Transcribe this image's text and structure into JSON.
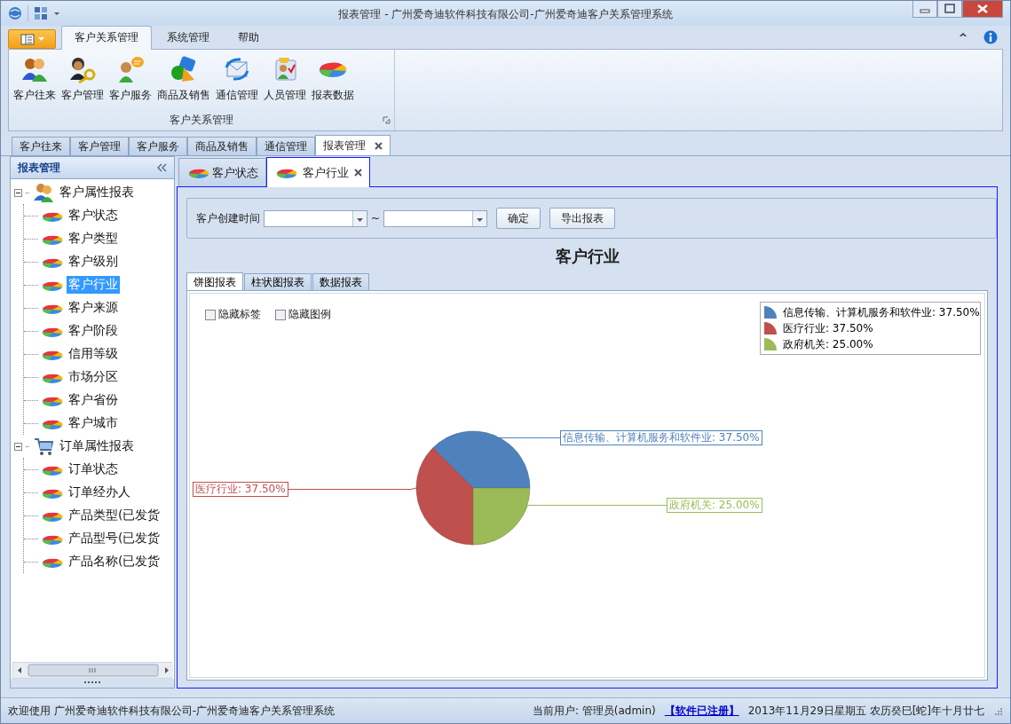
{
  "window": {
    "title": "报表管理 - 广州爱奇迪软件科技有限公司-广州爱奇迪客户关系管理系统"
  },
  "ribbon": {
    "tabs": [
      {
        "label": "客户关系管理",
        "selected": true
      },
      {
        "label": "系统管理",
        "selected": false
      },
      {
        "label": "帮助",
        "selected": false
      }
    ],
    "buttons": [
      "客户往来",
      "客户管理",
      "客户服务",
      "商品及销售",
      "通信管理",
      "人员管理",
      "报表数据"
    ],
    "group_label": "客户关系管理"
  },
  "document_tabs": [
    {
      "label": "客户往来",
      "selected": false
    },
    {
      "label": "客户管理",
      "selected": false
    },
    {
      "label": "客户服务",
      "selected": false
    },
    {
      "label": "商品及销售",
      "selected": false
    },
    {
      "label": "通信管理",
      "selected": false
    },
    {
      "label": "报表管理",
      "selected": true
    }
  ],
  "sidebar": {
    "title": "报表管理",
    "tree": [
      {
        "label": "客户属性报表",
        "expanded": true,
        "selected": false,
        "children": [
          {
            "label": "客户状态",
            "selected": false
          },
          {
            "label": "客户类型",
            "selected": false
          },
          {
            "label": "客户级别",
            "selected": false
          },
          {
            "label": "客户行业",
            "selected": true
          },
          {
            "label": "客户来源",
            "selected": false
          },
          {
            "label": "客户阶段",
            "selected": false
          },
          {
            "label": "信用等级",
            "selected": false
          },
          {
            "label": "市场分区",
            "selected": false
          },
          {
            "label": "客户省份",
            "selected": false
          },
          {
            "label": "客户城市",
            "selected": false
          }
        ]
      },
      {
        "label": "订单属性报表",
        "expanded": true,
        "selected": false,
        "children": [
          {
            "label": "订单状态",
            "selected": false
          },
          {
            "label": "订单经办人",
            "selected": false
          },
          {
            "label": "产品类型(已发货",
            "selected": false
          },
          {
            "label": "产品型号(已发货",
            "selected": false
          },
          {
            "label": "产品名称(已发货",
            "selected": false
          }
        ]
      }
    ]
  },
  "report_tabs": [
    {
      "label": "客户状态",
      "selected": false
    },
    {
      "label": "客户行业",
      "selected": true
    }
  ],
  "filter": {
    "label": "客户创建时间",
    "separator": "~",
    "buttons": [
      "确定",
      "导出报表"
    ]
  },
  "report_title": "客户行业",
  "chart_tabs": [
    {
      "label": "饼图报表",
      "selected": true
    },
    {
      "label": "柱状图报表",
      "selected": false
    },
    {
      "label": "数据报表",
      "selected": false
    }
  ],
  "options": [
    {
      "label": "隐藏标签",
      "checked": false
    },
    {
      "label": "隐藏图例",
      "checked": false
    }
  ],
  "legend": [
    {
      "label": "信息传输、计算机服务和软件业: 37.50%",
      "color": "#4f81bd"
    },
    {
      "label": "医疗行业: 37.50%",
      "color": "#c0504d"
    },
    {
      "label": "政府机关: 25.00%",
      "color": "#9bbb59"
    }
  ],
  "chart_data": {
    "type": "pie",
    "values": [
      37.5,
      37.5,
      25
    ],
    "value_labels": [
      "信息传输、计算机服务和软件业: 37.50%",
      "医疗行业: 37.50%",
      "政府机关: 25.00%"
    ]
  },
  "status_bar": {
    "welcome": "欢迎使用 广州爱奇迪软件科技有限公司-广州爱奇迪客户关系管理系统",
    "user": "当前用户: 管理员(admin)",
    "registration": "【软件已注册】",
    "date": "2013年11月29日星期五 农历癸巳[蛇]年十月廿七"
  }
}
